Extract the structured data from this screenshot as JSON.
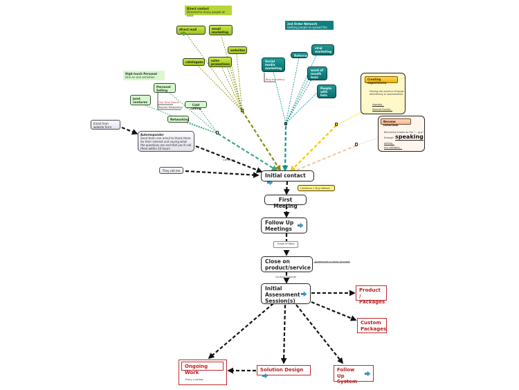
{
  "colors": {
    "lime": "#9bc41c",
    "olive_link": "#8a8a10",
    "teal": "#0f7c7a",
    "teal_link": "#14908d",
    "mint_link": "#3aa57a",
    "yellow_link": "#f5c800",
    "peach_link": "#f5c8a0",
    "black_link": "#111111",
    "red": "#c0282a"
  },
  "direct_contact": {
    "title": "Direct contact",
    "subtitle": "Directed to many people at once",
    "items": {
      "direct_mail": "direct mail",
      "email_marketing": "email marketing",
      "websites": "websites",
      "catalogues": "catalogues",
      "sales_promotions": "sales promotions"
    }
  },
  "second_order": {
    "title": "2nd Order Network",
    "subtitle": "Getting people to spread the word",
    "items": {
      "social_media": "Social media marketing",
      "blog_marketing": "Blog marketing",
      "referral": "Referral",
      "viral_marketing": "viral marketing",
      "word_of_mouth": "word of mouth buzz",
      "people_with_lists": "People with lists"
    }
  },
  "high_touch": {
    "title": "High-touch Personal",
    "subtitle": "One on one activities",
    "items": {
      "personal_selling": "Personal Selling",
      "one_time_events": "One Time Events",
      "regular_networking": "Regular Networking",
      "joint_ventures": "Joint ventures",
      "cold_calling": "Cold calling",
      "networking": "Networking"
    }
  },
  "experiences": {
    "title": "Creating experiences",
    "text": "Having the event or through advertising or sponsorships",
    "items": [
      "Aweatio",
      "Special Events"
    ]
  },
  "notorious": {
    "title": "Become notorious",
    "text": "Becoming known as the \"... guy\"",
    "through": "through",
    "emphasis": "speaking",
    "items": [
      "writing",
      "my category"
    ]
  },
  "left_inputs": {
    "email_form": "Email from website form",
    "autoresponder_title": "Autoresponder",
    "autoresponder_text": "Send them one email to thank them for their interest and saying what the questions are and that you'll call them within 24 hours",
    "call_them": "Call them",
    "they_call_me": "They call me"
  },
  "flow": {
    "initial_contact": "Initial contact",
    "confirm_note": "Confirms 1 Buy Before",
    "first_meeting": "First Meeting",
    "follow_up_meetings": "Follow Up Meetings",
    "scope_label": "Scope of Work",
    "close": "Close on product/service",
    "agreement_label": "Agreement or letter of intent",
    "go_front_label": "Go front material",
    "initial_assessment": "Initial Assessment Session(s)",
    "product_packages": "Product / Packages",
    "custom_packages": "Custom Packages",
    "ongoing_work": "Ongoing Work",
    "ongoing_note": "Every x period",
    "solution_design": "Solution Design",
    "follow_up_system": "Follow Up System"
  },
  "icons": {
    "hyperlink_arrow": "blue-arrow-icon",
    "lime_arrow": "green-arrow-icon"
  }
}
